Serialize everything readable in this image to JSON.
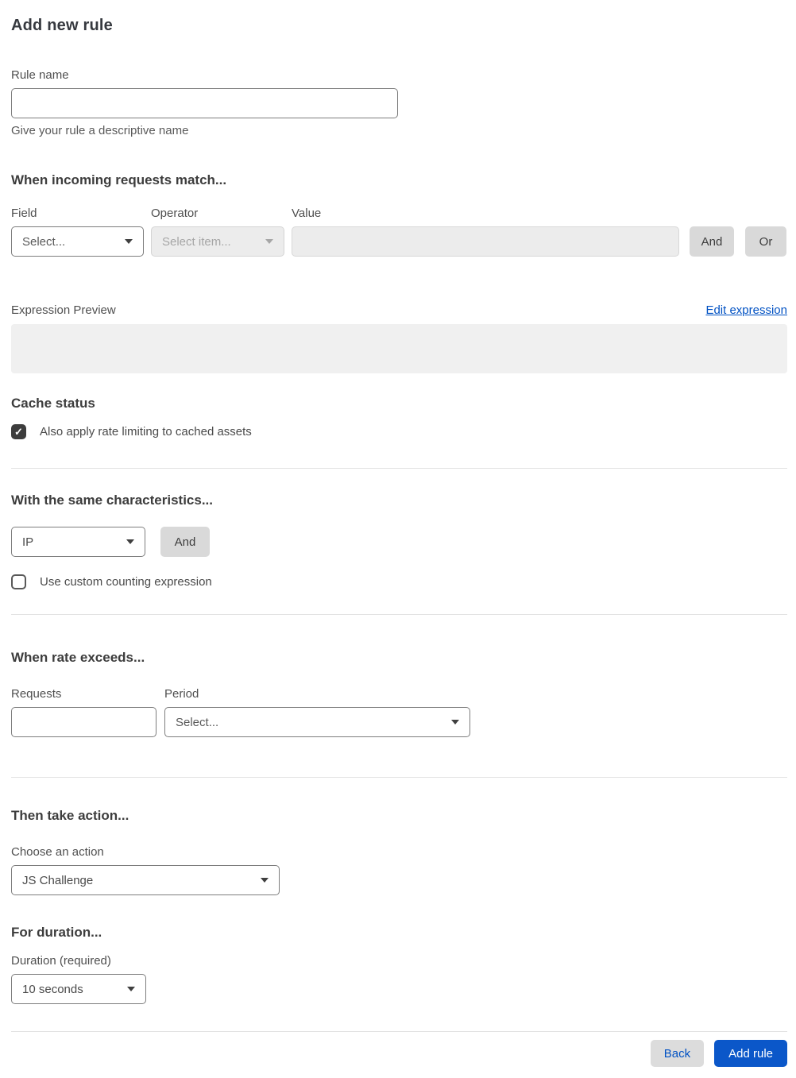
{
  "page": {
    "title": "Add new rule"
  },
  "rule_name": {
    "label": "Rule name",
    "value": "",
    "helper": "Give your rule a descriptive name"
  },
  "match_section": {
    "heading": "When incoming requests match...",
    "field": {
      "label": "Field",
      "selected": "Select..."
    },
    "operator": {
      "label": "Operator",
      "selected": "Select item...",
      "disabled": true
    },
    "value": {
      "label": "Value",
      "value": "",
      "disabled": true
    },
    "and_button": "And",
    "or_button": "Or"
  },
  "expression": {
    "label": "Expression Preview",
    "edit_link": "Edit expression",
    "preview": ""
  },
  "cache_status": {
    "heading": "Cache status",
    "checkbox_label": "Also apply rate limiting to cached assets",
    "checked": true
  },
  "characteristics": {
    "heading": "With the same characteristics...",
    "selected": "IP",
    "and_button": "And",
    "checkbox_label": "Use custom counting expression",
    "checked": false
  },
  "rate": {
    "heading": "When rate exceeds...",
    "requests": {
      "label": "Requests",
      "value": ""
    },
    "period": {
      "label": "Period",
      "selected": "Select..."
    }
  },
  "action": {
    "heading": "Then take action...",
    "label": "Choose an action",
    "selected": "JS Challenge"
  },
  "duration": {
    "heading": "For duration...",
    "label": "Duration (required)",
    "selected": "10 seconds"
  },
  "footer": {
    "back_label": "Back",
    "add_rule_label": "Add rule"
  },
  "icons": {
    "check": "✓",
    "chevron_down": "▾"
  },
  "colors": {
    "link_blue": "#0051c3",
    "primary_button_blue": "#0b57c9",
    "checkbox_checked": "#3d3d3d",
    "disabled_fill": "#ececec"
  }
}
